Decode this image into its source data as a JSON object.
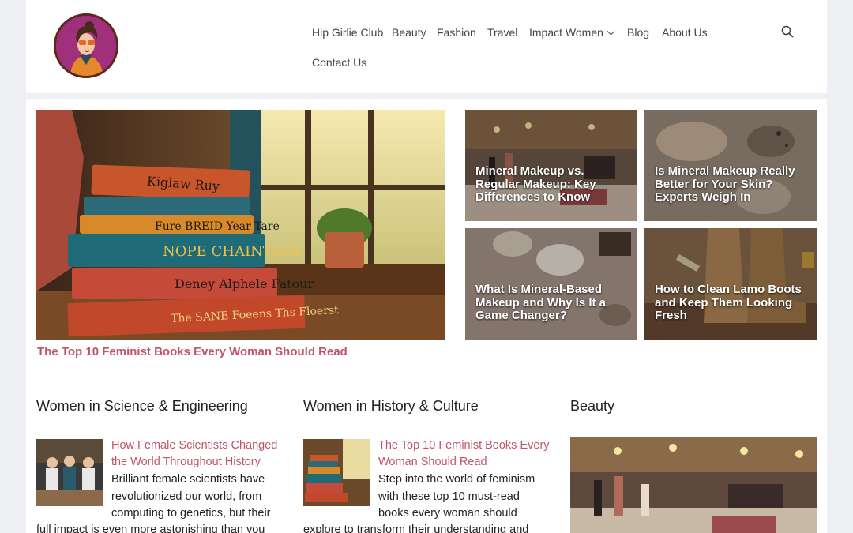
{
  "header": {
    "nav": [
      {
        "label": "Hip Girlie Club"
      },
      {
        "label": "Beauty"
      },
      {
        "label": "Fashion"
      },
      {
        "label": "Travel"
      },
      {
        "label": "Impact Women"
      },
      {
        "label": "Blog"
      },
      {
        "label": "About Us"
      },
      {
        "label": "Contact Us"
      }
    ]
  },
  "featured": {
    "hero_title": "The Top 10 Feminist Books Every Woman Should Read",
    "hero_book_spines": [
      "Kiglaw Ruy",
      "Fure BREID Year Tare",
      "NOPE CHAINTORI",
      "Deney Alphele Fatour",
      "The SANE Foeens Ths Floerst"
    ],
    "cards": [
      {
        "title": "Mineral Makeup vs. Regular Makeup: Key Differences to Know"
      },
      {
        "title": "Is Mineral Makeup Really Better for Your Skin? Experts Weigh In"
      },
      {
        "title": "What Is Mineral-Based Makeup and Why Is It a Game Changer?"
      },
      {
        "title": "How to Clean Lamo Boots and Keep Them Looking Fresh"
      }
    ]
  },
  "columns": [
    {
      "heading": "Women in Science & Engineering",
      "post_title": "How Female Scientists Changed the World Throughout History",
      "excerpt_a": "Brilliant female scientists have revolutionized our world, from computing to genetics, but their",
      "excerpt_b": "full impact is even more astonishing than you"
    },
    {
      "heading": "Women in History & Culture",
      "post_title": "The Top 10 Feminist Books Every Woman Should Read",
      "excerpt_a": "Step into the world of feminism with these top 10 must-read books every woman should",
      "excerpt_b": "explore to transform their understanding and"
    },
    {
      "heading": "Beauty"
    }
  ],
  "colors": {
    "accent": "#c0546a",
    "background": "#eef0f3",
    "panel": "#ffffff"
  }
}
